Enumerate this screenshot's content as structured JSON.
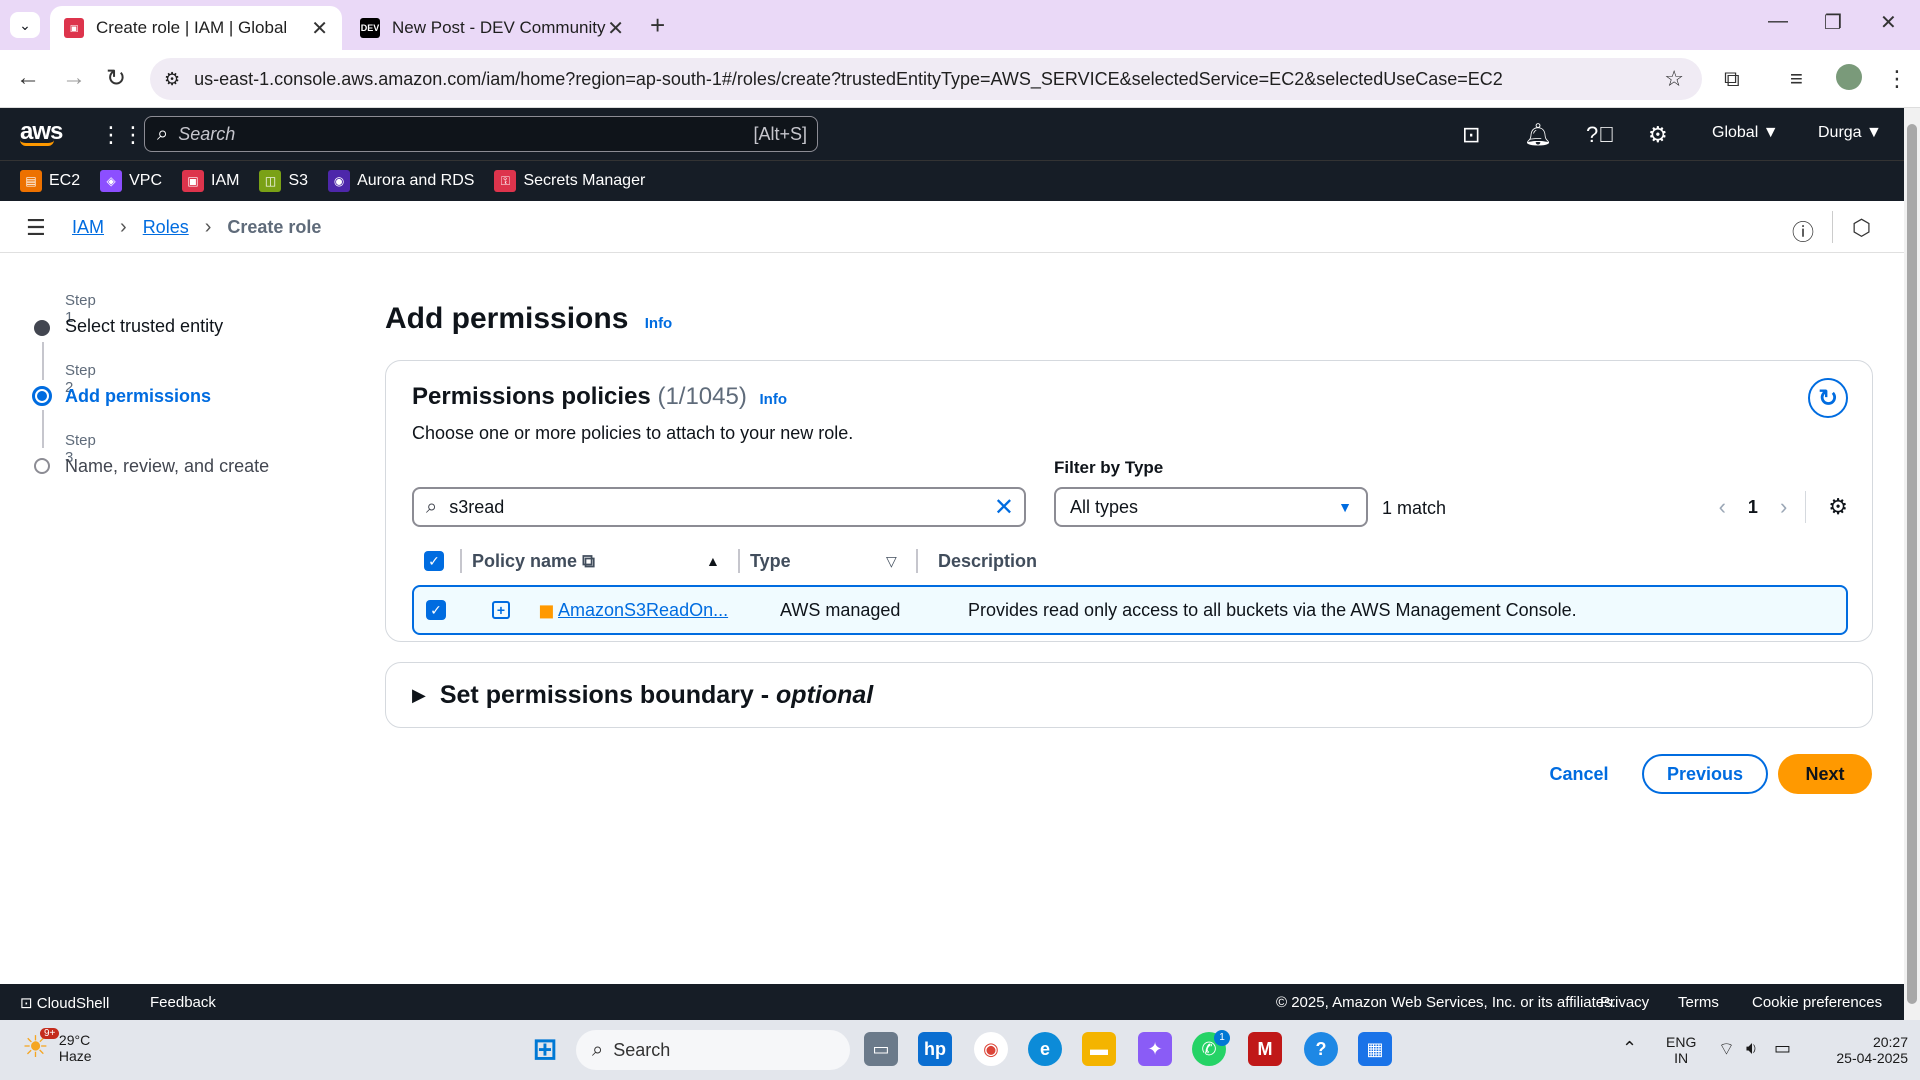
{
  "browser": {
    "tabs": [
      {
        "title": "Create role | IAM | Global",
        "active": true
      },
      {
        "title": "New Post - DEV Community",
        "active": false
      }
    ],
    "url": "us-east-1.console.aws.amazon.com/iam/home?region=ap-south-1#/roles/create?trustedEntityType=AWS_SERVICE&selectedService=EC2&selectedUseCase=EC2",
    "dev_favicon": "DEV"
  },
  "aws_nav": {
    "logo": "aws",
    "search_placeholder": "Search",
    "search_shortcut": "[Alt+S]",
    "region": "Global",
    "user": "Durga",
    "favorites": [
      {
        "label": "EC2",
        "color": "#ed7100"
      },
      {
        "label": "VPC",
        "color": "#8c4fff"
      },
      {
        "label": "IAM",
        "color": "#dd344c"
      },
      {
        "label": "S3",
        "color": "#7aa116"
      },
      {
        "label": "Aurora and RDS",
        "color": "#4d27aa"
      },
      {
        "label": "Secrets Manager",
        "color": "#dd344c"
      }
    ]
  },
  "breadcrumb": {
    "items": [
      "IAM",
      "Roles"
    ],
    "current": "Create role"
  },
  "steps": [
    {
      "num": "Step 1",
      "title": "Select trusted entity",
      "state": "done"
    },
    {
      "num": "Step 2",
      "title": "Add permissions",
      "state": "current"
    },
    {
      "num": "Step 3",
      "title": "Name, review, and create",
      "state": "todo"
    }
  ],
  "page": {
    "title": "Add permissions",
    "info": "Info"
  },
  "policies": {
    "title": "Permissions policies",
    "count": "(1/1045)",
    "info": "Info",
    "description": "Choose one or more policies to attach to your new role.",
    "filter_label": "Filter by Type",
    "search_value": "s3read",
    "filter_value": "All types",
    "match_text": "1 match",
    "page_number": "1",
    "columns": {
      "name": "Policy name",
      "type": "Type",
      "description": "Description"
    },
    "rows": [
      {
        "name": "AmazonS3ReadOn...",
        "type": "AWS managed",
        "description": "Provides read only access to all buckets via the AWS Management Console.",
        "checked": true
      }
    ]
  },
  "boundary": {
    "title": "Set permissions boundary - ",
    "optional": "optional"
  },
  "actions": {
    "cancel": "Cancel",
    "previous": "Previous",
    "next": "Next"
  },
  "footer": {
    "cloudshell": "CloudShell",
    "feedback": "Feedback",
    "copyright": "© 2025, Amazon Web Services, Inc. or its affiliates.",
    "privacy": "Privacy",
    "terms": "Terms",
    "cookies": "Cookie preferences"
  },
  "taskbar": {
    "temperature": "29°C",
    "condition": "Haze",
    "weather_badge": "9+",
    "search": "Search",
    "whatsapp_badge": "1",
    "lang_top": "ENG",
    "lang_bottom": "IN",
    "time": "20:27",
    "date": "25-04-2025"
  }
}
